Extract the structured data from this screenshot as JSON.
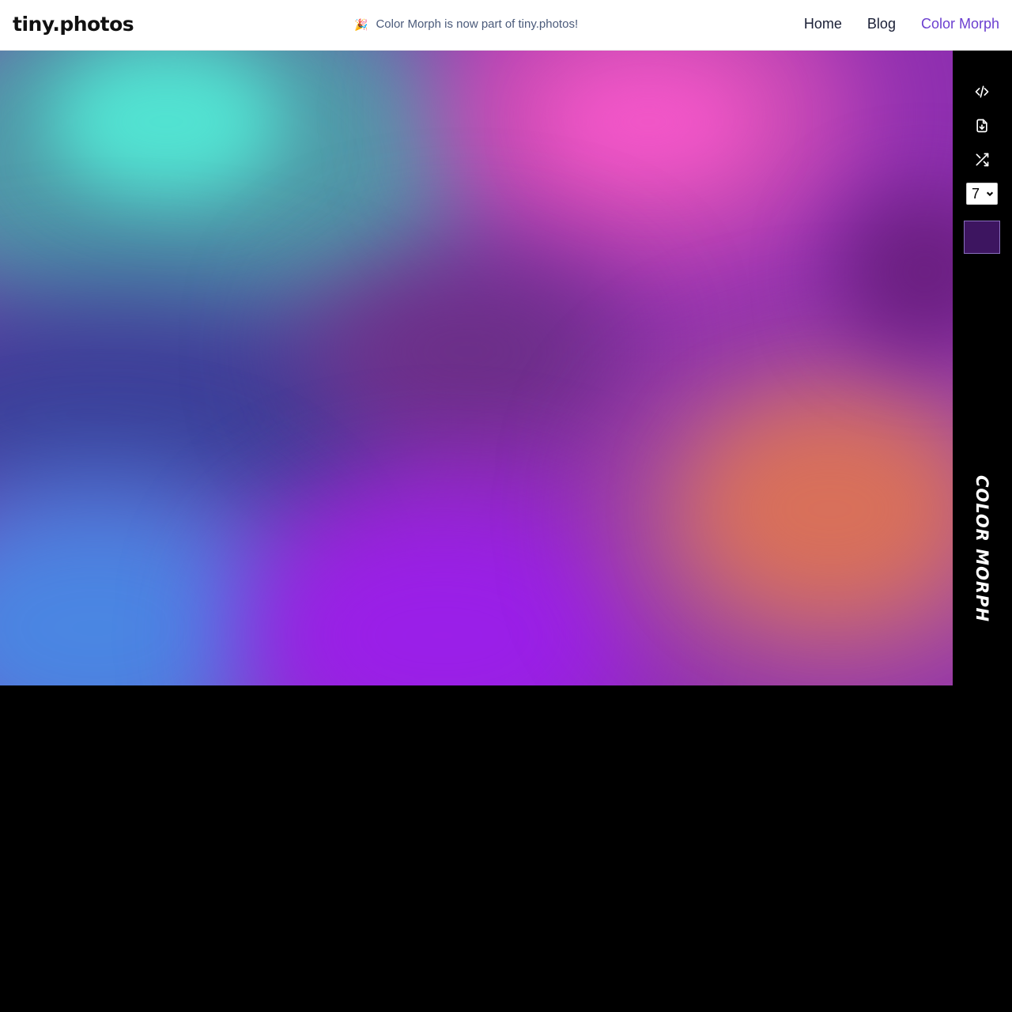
{
  "header": {
    "logo": "tiny.photos",
    "announcement": {
      "icon": "party-popper-icon",
      "emoji": "🎉",
      "text": "Color Morph is now part of tiny.photos!"
    },
    "nav": [
      {
        "label": "Home",
        "active": false
      },
      {
        "label": "Blog",
        "active": false
      },
      {
        "label": "Color Morph",
        "active": true
      }
    ],
    "accent_color": "#6b3fd0"
  },
  "canvas": {
    "colors": [
      "#52e3d2",
      "#f256c8",
      "#4a86e2",
      "#9a1fe8",
      "#d8705a",
      "#3b3f98",
      "#7a2a8a"
    ]
  },
  "toolbar": {
    "tools": [
      {
        "name": "embed-code-icon"
      },
      {
        "name": "download-file-icon"
      },
      {
        "name": "shuffle-icon"
      }
    ],
    "count_select": {
      "value": "7"
    },
    "swatch_color": "#3d1560",
    "brand_label": "COLOR MORPH"
  }
}
